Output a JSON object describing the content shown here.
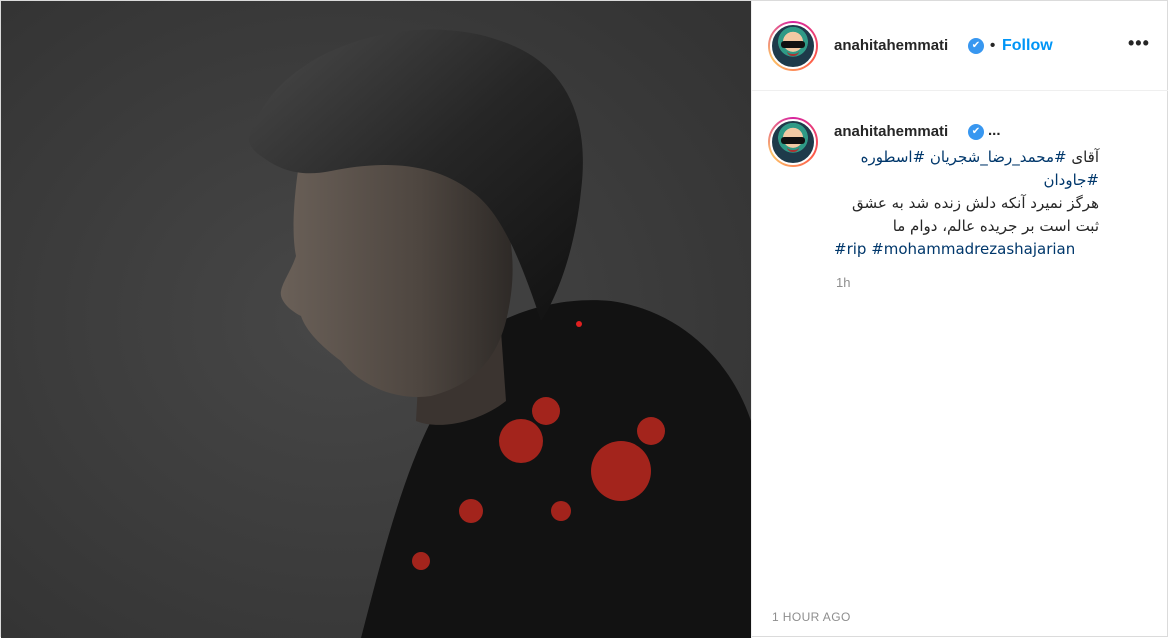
{
  "post": {
    "image_alt": "",
    "header": {
      "username": "anahitahemmati",
      "verified_mark": "✔",
      "separator": "•",
      "follow_label": "Follow",
      "more_label": "•••"
    },
    "caption": {
      "username": "anahitahemmati",
      "verified_mark": "✔",
      "ellipsis": "...",
      "line1_text": "آقای ",
      "line1_tags": "#محمد_رضا_شجریان #اسطوره",
      "line2_tag": "#جاودان",
      "line3": "هرگز نمیرد آنکه دلش زنده شد به عشق",
      "line4": "ثبت است بر جریده عالم، دوام ما",
      "line5_tags": "#rip #mohammadrezashajarian",
      "time_ago": "1h"
    },
    "timestamp": "1 HOUR AGO"
  },
  "colors": {
    "accent": "#0095f6",
    "hashtag": "#00376b",
    "muted": "#8e8e8e",
    "photo_background": "#3c3c3c",
    "flower_red": "#b3261e"
  },
  "icons": {
    "verified": "verified-badge-icon",
    "more": "more-options-icon"
  }
}
